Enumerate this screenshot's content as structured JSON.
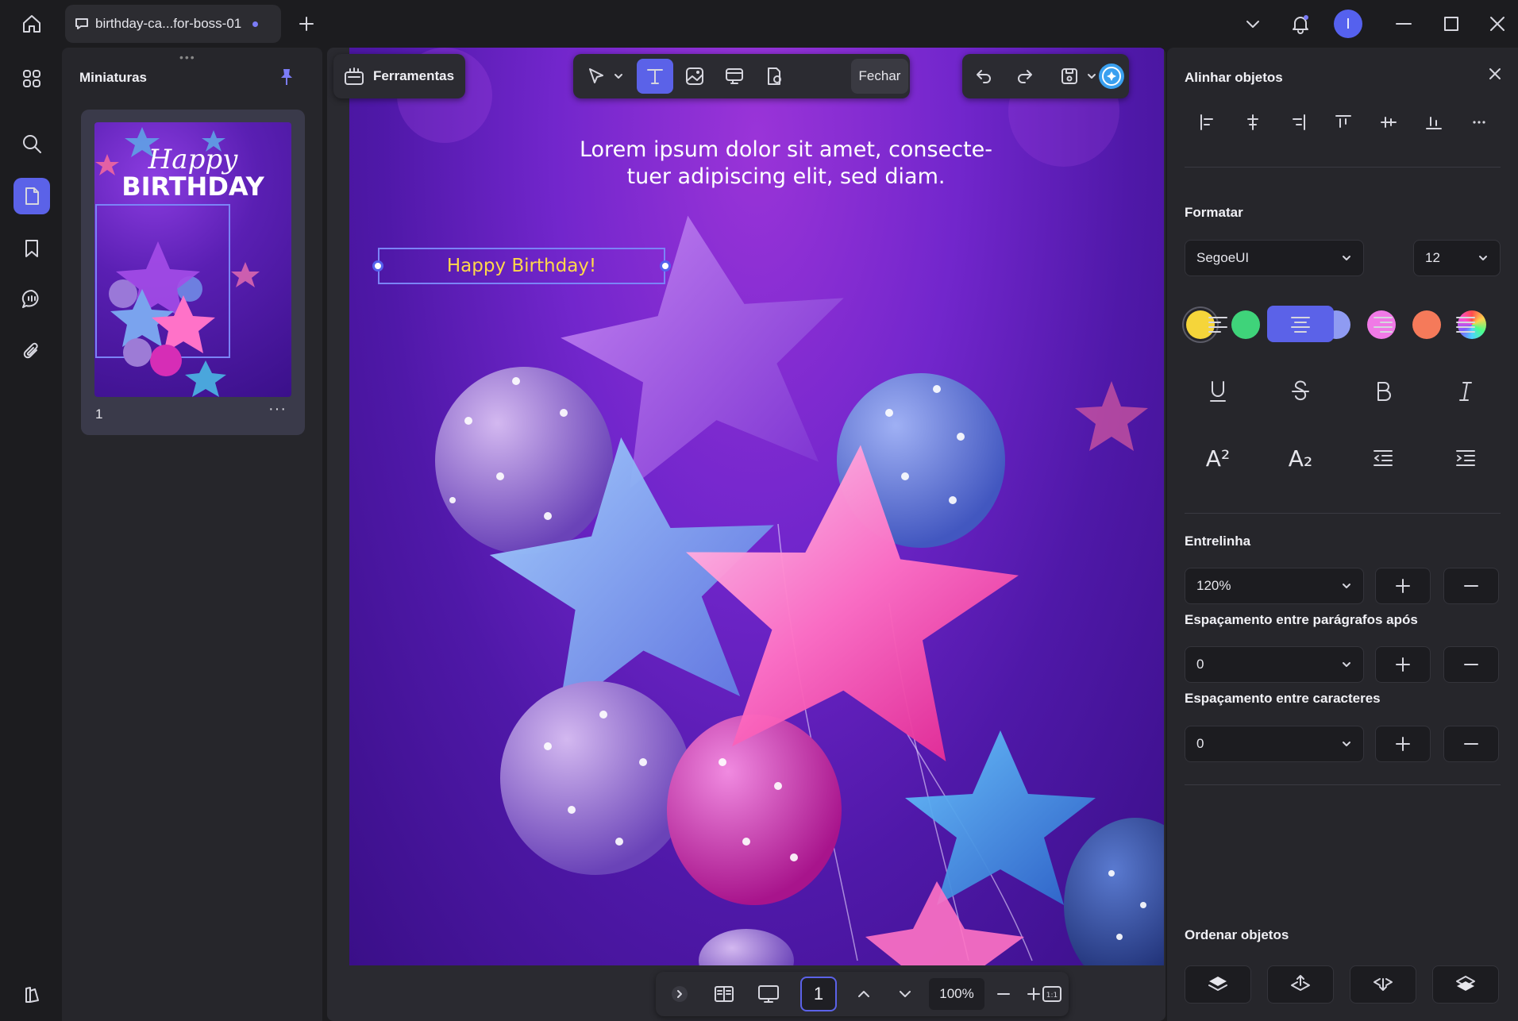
{
  "tab": {
    "title": "birthday-ca...for-boss-01"
  },
  "thumbnails": {
    "title": "Miniaturas",
    "page_label": "1",
    "more": "···"
  },
  "toolbar": {
    "tools_label": "Ferramentas",
    "close_label": "Fechar"
  },
  "canvas": {
    "lorem_line1": "Lorem ipsum dolor sit amet, consecte-",
    "lorem_line2": "tuer adipiscing elit, sed diam.",
    "textbox_text": "Happy Birthday!"
  },
  "bottom": {
    "page_number": "1",
    "zoom": "100%"
  },
  "panel": {
    "align_title": "Alinhar objetos",
    "format_title": "Formatar",
    "font": "SegoeUI",
    "font_size": "12",
    "line_spacing_title": "Entrelinha",
    "line_spacing_value": "120%",
    "para_spacing_title": "Espaçamento entre parágrafos após",
    "para_spacing_value": "0",
    "char_spacing_title": "Espaçamento entre caracteres",
    "char_spacing_value": "0",
    "order_title": "Ordenar  objetos",
    "swatches": [
      "#f5d53a",
      "#3fd37a",
      "#36d6e8",
      "#8f9bf2",
      "#f07ae6",
      "#f57a5a"
    ],
    "accent": "#5b62e8",
    "superscript": "A²",
    "subscript": "A₂"
  }
}
